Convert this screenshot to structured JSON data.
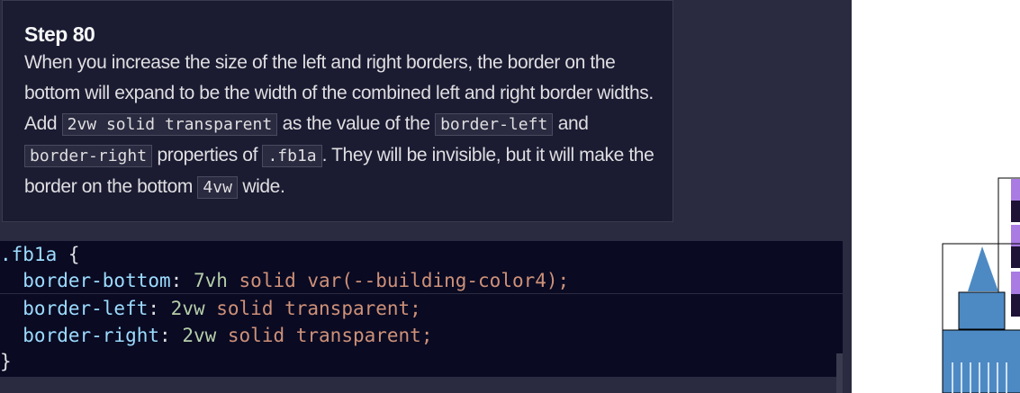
{
  "step": {
    "title": "Step 80"
  },
  "description": {
    "p1": "When you increase the size of the left and right borders, the border on the bottom will expand to be the width of the combined left and right border widths. Add ",
    "c1": "2vw solid transparent",
    "p2": " as the value of the ",
    "c2": "border-left",
    "p3": " and ",
    "c3": "border-right",
    "p4": " properties of ",
    "c4": ".fb1a",
    "p5": ". They will be invisible, but it will make the border on the bottom ",
    "c5": "4vw",
    "p6": " wide."
  },
  "editor": {
    "line1": {
      "selector": ".fb1a",
      "brace": " {"
    },
    "line2": {
      "prop": "  border-bottom",
      "colon": ": ",
      "num": "7vh",
      "rest": " solid var(--building-color4);"
    },
    "line3": {
      "prop": "  border-left",
      "colon": ": ",
      "num": "2vw",
      "rest": " solid transparent;"
    },
    "line4": {
      "prop": "  border-right",
      "colon": ": ",
      "num": "2vw",
      "rest": " solid transparent;"
    },
    "line5": {
      "brace": "}"
    }
  },
  "colors": {
    "building_blue": "#4d8ac4",
    "building_purple": "#a97be3",
    "building_dark": "#1e1236"
  }
}
